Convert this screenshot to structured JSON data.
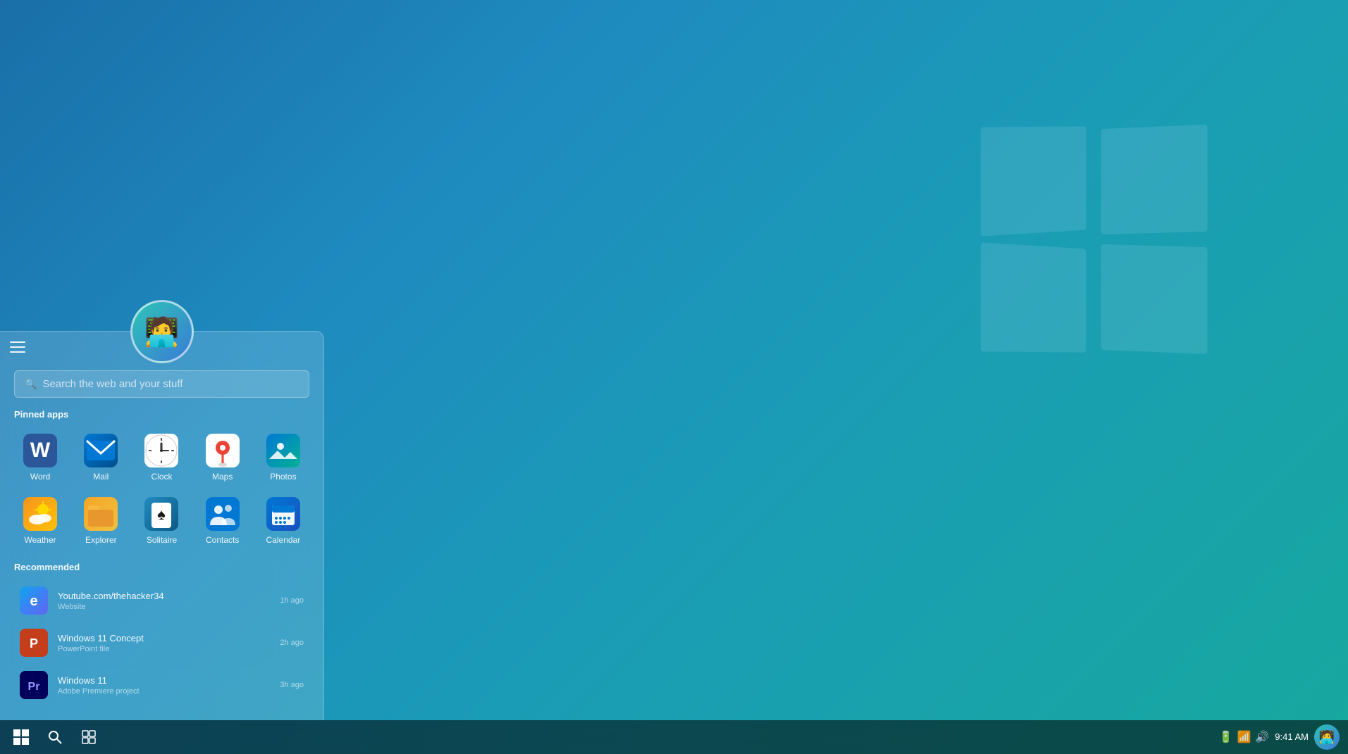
{
  "desktop": {
    "background": "blue-gradient"
  },
  "start_menu": {
    "hamburger_label": "☰",
    "search_placeholder": "Search the web and your stuff",
    "pinned_title": "Pinned apps",
    "recommended_title": "Recommended",
    "pinned_apps": [
      {
        "id": "word",
        "label": "Word",
        "icon_type": "word"
      },
      {
        "id": "mail",
        "label": "Mail",
        "icon_type": "mail"
      },
      {
        "id": "clock",
        "label": "Clock",
        "icon_type": "clock"
      },
      {
        "id": "maps",
        "label": "Maps",
        "icon_type": "maps"
      },
      {
        "id": "photos",
        "label": "Photos",
        "icon_type": "photos"
      },
      {
        "id": "weather",
        "label": "Weather",
        "icon_type": "weather"
      },
      {
        "id": "explorer",
        "label": "Explorer",
        "icon_type": "explorer"
      },
      {
        "id": "solitaire",
        "label": "Solitaire",
        "icon_type": "solitaire"
      },
      {
        "id": "contacts",
        "label": "Contacts",
        "icon_type": "contacts"
      },
      {
        "id": "calendar",
        "label": "Calendar",
        "icon_type": "calendar"
      }
    ],
    "recommended_items": [
      {
        "id": "youtube",
        "name": "Youtube.com/thehacker34",
        "type": "Website",
        "time": "1h ago",
        "icon_type": "edge"
      },
      {
        "id": "windows11concept",
        "name": "Windows 11 Concept",
        "type": "PowerPoint file",
        "time": "2h ago",
        "icon_type": "powerpoint"
      },
      {
        "id": "windows11",
        "name": "Windows 11",
        "type": "Adobe Premiere project",
        "time": "3h ago",
        "icon_type": "premiere"
      }
    ]
  },
  "taskbar": {
    "start_icon": "⊞",
    "search_icon": "🔍",
    "task_view_icon": "⧉",
    "clock": "9:41 AM",
    "sys_icons": [
      "🔋",
      "📶",
      "🔊"
    ]
  },
  "user": {
    "avatar_emoji": "🧑‍💻"
  }
}
